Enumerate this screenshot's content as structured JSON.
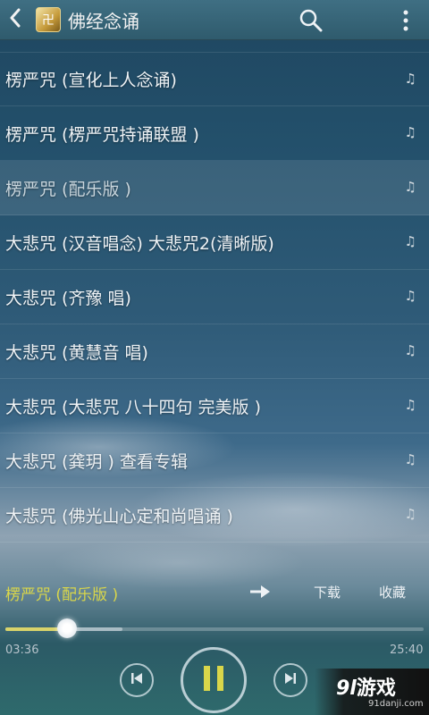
{
  "header": {
    "title": "佛经念诵",
    "back_icon": "back-chevron-icon",
    "logo_icon": "app-logo-icon",
    "search_icon": "search-icon",
    "more_icon": "more-vertical-icon"
  },
  "list": {
    "items": [
      {
        "label": "楞严咒 (宣化上人念诵)",
        "icon": "music-note-icon",
        "note": "♫"
      },
      {
        "label": "楞严咒 (楞严咒持诵联盟 )",
        "icon": "music-note-icon",
        "note": "♫"
      },
      {
        "label": "楞严咒 (配乐版 )",
        "icon": "music-note-icon",
        "note": "♫",
        "selected": true
      },
      {
        "label": "大悲咒 (汉音唱念) 大悲咒2(清晰版)",
        "icon": "music-note-icon",
        "note": "♫"
      },
      {
        "label": "大悲咒 (齐豫 唱)",
        "icon": "music-note-icon",
        "note": "♫"
      },
      {
        "label": "大悲咒 (黄慧音 唱)",
        "icon": "music-note-icon",
        "note": "♫"
      },
      {
        "label": "大悲咒 (大悲咒 八十四句 完美版 )",
        "icon": "music-note-icon",
        "note": "♫"
      },
      {
        "label": "大悲咒 (龚玥 ) 查看专辑",
        "icon": "music-note-icon",
        "note": "♫"
      },
      {
        "label": "大悲咒 (佛光山心定和尚唱诵 )",
        "icon": "music-note-icon",
        "note": "♫"
      }
    ]
  },
  "now_playing": {
    "track": "楞严咒 (配乐版 )",
    "share_icon": "arrow-right-icon",
    "download_label": "下载",
    "favorite_label": "收藏"
  },
  "progress": {
    "current_time": "03:36",
    "total_time": "25:40",
    "played_fraction": 0.14
  },
  "controls": {
    "prev_icon": "previous-icon",
    "play_pause_icon": "pause-icon",
    "next_icon": "next-icon"
  },
  "watermark": {
    "brand_num": "9l",
    "brand_text": "游戏",
    "site": "91danji.com"
  },
  "colors": {
    "accent_track": "#d9d64a",
    "header_bg": "#3f6f83"
  }
}
